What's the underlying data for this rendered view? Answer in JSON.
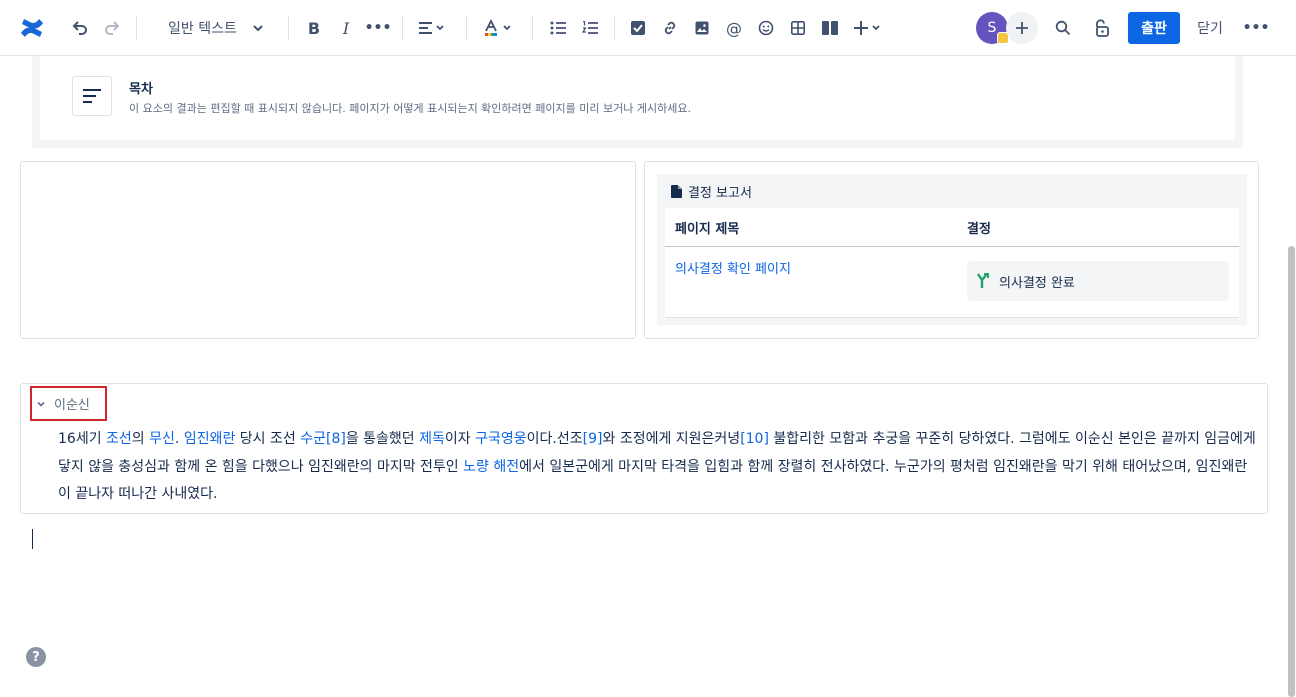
{
  "toolbar": {
    "text_style": "일반 텍스트",
    "avatar_initial": "S",
    "publish_label": "출판",
    "close_label": "닫기"
  },
  "toc": {
    "title": "목차",
    "description": "이 요소의 결과는 편집할 때 표시되지 않습니다. 페이지가 어떻게 표시되는지 확인하려면 페이지를 미리 보거나 게시하세요."
  },
  "decision_report": {
    "title": "결정 보고서",
    "columns": [
      "페이지 제목",
      "결정"
    ],
    "rows": [
      {
        "page": "의사결정 확인 페이지",
        "decision": "의사결정 완료"
      }
    ]
  },
  "expand": {
    "title": "이순신",
    "segments": [
      {
        "t": "16세기 "
      },
      {
        "t": "조선",
        "link": true
      },
      {
        "t": "의 "
      },
      {
        "t": "무신",
        "link": true
      },
      {
        "t": ". "
      },
      {
        "t": "임진왜란",
        "link": true
      },
      {
        "t": " 당시 조선 "
      },
      {
        "t": "수군",
        "link": true
      },
      {
        "t": "[8]",
        "link": true
      },
      {
        "t": "을 통솔했던 "
      },
      {
        "t": "제독",
        "link": true
      },
      {
        "t": "이자 "
      },
      {
        "t": "구국영웅",
        "link": true
      },
      {
        "t": "이다.선조"
      },
      {
        "t": "[9]",
        "link": true
      },
      {
        "t": "와 조정에게 지원은커녕"
      },
      {
        "t": "[10]",
        "link": true
      },
      {
        "t": " 불합리한 모함과 추궁을 꾸준히 당하였다. 그럼에도 이순신 본인은 끝까지 임금에게 닿지 않을 충성심과 함께 온 힘을 다했으나 임진왜란의 마지막 전투인 "
      },
      {
        "t": "노량 해전",
        "link": true
      },
      {
        "t": "에서 일본군에게 마지막 타격을 입힘과 함께 장렬히 전사하였다. 누군가의 평처럼 임진왜란을 막기 위해 태어났으며, 임진왜란이 끝나자 떠나간 사내였다."
      }
    ]
  },
  "help_label": "?",
  "colors": {
    "accent": "#0c66e4",
    "highlight_border": "#d0272e",
    "avatar": "#6554c0",
    "decision_icon": "#22a06b"
  }
}
